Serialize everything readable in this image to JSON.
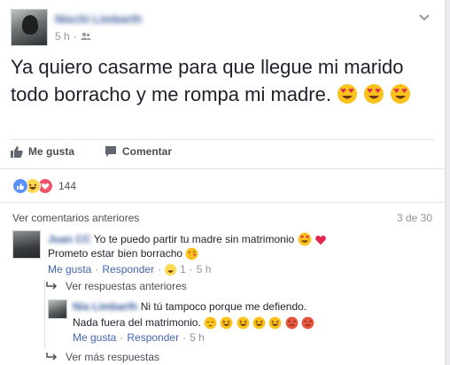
{
  "post": {
    "author": "Niechi Limbarth",
    "time": "5 h",
    "text": "Ya quiero casarme para que llegue mi marido todo borracho y me rompa mi madre.",
    "emoji_icons": [
      "heart-eyes-emoji",
      "heart-eyes-emoji",
      "heart-eyes-emoji"
    ]
  },
  "actions": {
    "like": "Me gusta",
    "comment": "Comentar"
  },
  "reactions": {
    "icons": [
      "like-reaction-icon",
      "haha-reaction-icon",
      "love-reaction-icon"
    ],
    "count": "144"
  },
  "comments_section": {
    "view_previous": "Ver comentarios anteriores",
    "page": "3 de 30"
  },
  "comment1": {
    "author": "Juan CC",
    "line1": "Yo te puedo partir tu madre sin matrimonio",
    "line2": "Prometo estar bien borracho",
    "like": "Me gusta",
    "reply": "Responder",
    "reaction_count": "1",
    "time": "5 h"
  },
  "replies": {
    "view_previous": "Ver respuestas anteriores",
    "view_more": "Ver más respuestas"
  },
  "reply1": {
    "author": "Nia Limbarth",
    "line1": "Ni tú tampoco porque me defiendo.",
    "line2": "Nada fuera del matrimonio.",
    "like": "Me gusta",
    "reply": "Responder",
    "time": "5 h"
  },
  "colors": {
    "link": "#365899",
    "action_link": "#4267b2",
    "muted": "#90949c",
    "like_blue": "#5890ff",
    "love_red": "#f25268",
    "haha_yellow": "#fcd94f"
  }
}
